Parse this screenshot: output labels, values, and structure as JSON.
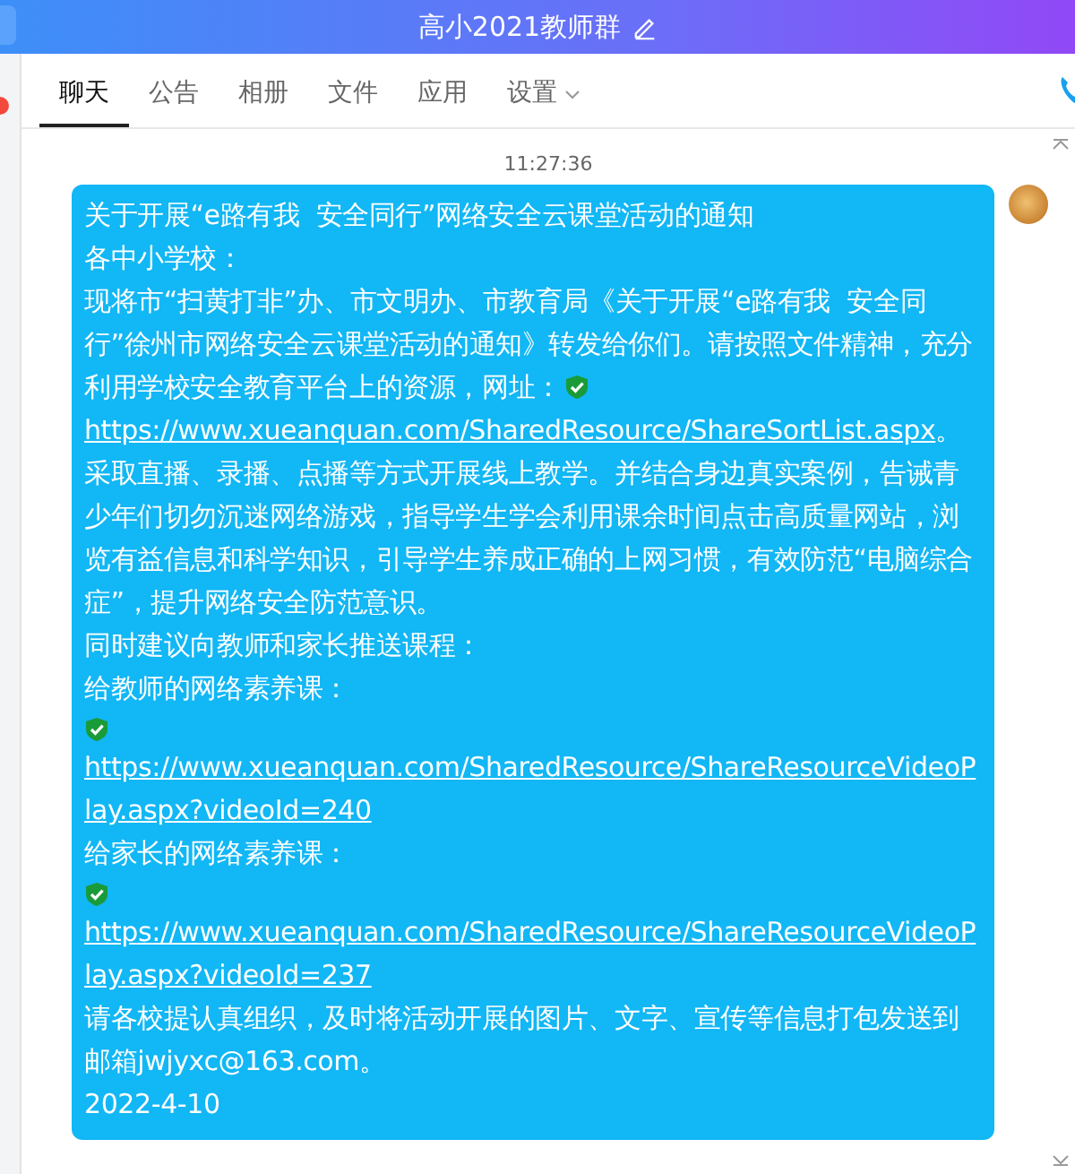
{
  "window": {
    "title": "高小2021教师群"
  },
  "tabs": [
    {
      "label": "聊天",
      "selected": true,
      "dropdown": false
    },
    {
      "label": "公告",
      "selected": false,
      "dropdown": false
    },
    {
      "label": "相册",
      "selected": false,
      "dropdown": false
    },
    {
      "label": "文件",
      "selected": false,
      "dropdown": false
    },
    {
      "label": "应用",
      "selected": false,
      "dropdown": false
    },
    {
      "label": "设置",
      "selected": false,
      "dropdown": true
    }
  ],
  "chat": {
    "timestamp": "11:27:36",
    "message": {
      "paragraphs": [
        {
          "segments": [
            {
              "kind": "text",
              "text": "关于开展“e路有我  安全同行”网络安全云课堂活动的通知"
            }
          ]
        },
        {
          "segments": [
            {
              "kind": "text",
              "text": "各中小学校："
            }
          ]
        },
        {
          "segments": [
            {
              "kind": "text",
              "text": "现将市“扫黄打非”办、市文明办、市教育局《关于开展“e路有我  安全同行”徐州市网络安全云课堂活动的通知》转发给你们。请按照文件精神，充分利用学校安全教育平台上的资源，网址："
            },
            {
              "kind": "check"
            },
            {
              "kind": "link",
              "text": "https://www.xueanquan.com/SharedResource/ShareSortList.aspx"
            },
            {
              "kind": "text",
              "text": "。采取直播、录播、点播等方式开展线上教学。并结合身边真实案例，告诫青少年们切勿沉迷网络游戏，指导学生学会利用课余时间点击高质量网站，浏览有益信息和科学知识，引导学生养成正确的上网习惯，有效防范“电脑综合症”，提升网络安全防范意识。"
            }
          ]
        },
        {
          "segments": [
            {
              "kind": "text",
              "text": "同时建议向教师和家长推送课程："
            }
          ]
        },
        {
          "segments": [
            {
              "kind": "text",
              "text": "给教师的网络素养课："
            }
          ]
        },
        {
          "segments": [
            {
              "kind": "check"
            },
            {
              "kind": "link",
              "text": "https://www.xueanquan.com/SharedResource/ShareResourceVideoPlay.aspx?videoId=240"
            }
          ]
        },
        {
          "segments": [
            {
              "kind": "text",
              "text": "给家长的网络素养课："
            }
          ]
        },
        {
          "segments": [
            {
              "kind": "check"
            },
            {
              "kind": "link",
              "text": "https://www.xueanquan.com/SharedResource/ShareResourceVideoPlay.aspx?videoId=237"
            }
          ]
        },
        {
          "segments": [
            {
              "kind": "text",
              "text": "请各校提认真组织，及时将活动开展的图片、文字、宣传等信息打包发送到邮箱jwjyxc@163.com。"
            }
          ]
        },
        {
          "segments": [
            {
              "kind": "text",
              "text": "2022-4-10"
            }
          ]
        }
      ]
    }
  }
}
